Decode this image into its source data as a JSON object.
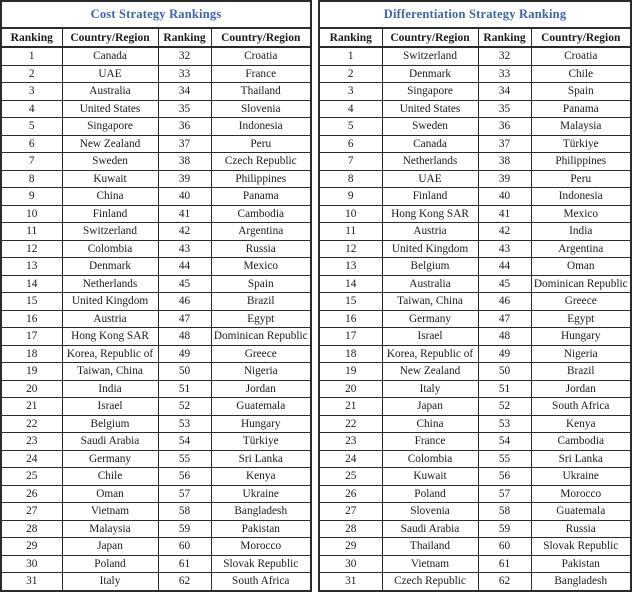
{
  "tables": [
    {
      "id": "cost-strategy",
      "title": "Cost Strategy Rankings",
      "title_color": "#3c63ab",
      "headers": [
        "Ranking",
        "Country/Region",
        "Ranking",
        "Country/Region"
      ],
      "rows": [
        [
          "1",
          "Canada",
          "32",
          "Croatia"
        ],
        [
          "2",
          "UAE",
          "33",
          "France"
        ],
        [
          "3",
          "Australia",
          "34",
          "Thailand"
        ],
        [
          "4",
          "United States",
          "35",
          "Slovenia"
        ],
        [
          "5",
          "Singapore",
          "36",
          "Indonesia"
        ],
        [
          "6",
          "New Zealand",
          "37",
          "Peru"
        ],
        [
          "7",
          "Sweden",
          "38",
          "Czech Republic"
        ],
        [
          "8",
          "Kuwait",
          "39",
          "Philippines"
        ],
        [
          "9",
          "China",
          "40",
          "Panama"
        ],
        [
          "10",
          "Finland",
          "41",
          "Cambodia"
        ],
        [
          "11",
          "Switzerland",
          "42",
          "Argentina"
        ],
        [
          "12",
          "Colombia",
          "43",
          "Russia"
        ],
        [
          "13",
          "Denmark",
          "44",
          "Mexico"
        ],
        [
          "14",
          "Netherlands",
          "45",
          "Spain"
        ],
        [
          "15",
          "United Kingdom",
          "46",
          "Brazil"
        ],
        [
          "16",
          "Austria",
          "47",
          "Egypt"
        ],
        [
          "17",
          "Hong Kong SAR",
          "48",
          "Dominican Republic"
        ],
        [
          "18",
          "Korea, Republic of",
          "49",
          "Greece"
        ],
        [
          "19",
          "Taiwan, China",
          "50",
          "Nigeria"
        ],
        [
          "20",
          "India",
          "51",
          "Jordan"
        ],
        [
          "21",
          "Israel",
          "52",
          "Guatemala"
        ],
        [
          "22",
          "Belgium",
          "53",
          "Hungary"
        ],
        [
          "23",
          "Saudi Arabia",
          "54",
          "Türkiye"
        ],
        [
          "24",
          "Germany",
          "55",
          "Sri Lanka"
        ],
        [
          "25",
          "Chile",
          "56",
          "Kenya"
        ],
        [
          "26",
          "Oman",
          "57",
          "Ukraine"
        ],
        [
          "27",
          "Vietnam",
          "58",
          "Bangladesh"
        ],
        [
          "28",
          "Malaysia",
          "59",
          "Pakistan"
        ],
        [
          "29",
          "Japan",
          "60",
          "Morocco"
        ],
        [
          "30",
          "Poland",
          "61",
          "Slovak Republic"
        ],
        [
          "31",
          "Italy",
          "62",
          "South Africa"
        ]
      ]
    },
    {
      "id": "differentiation-strategy",
      "title": "Differentiation Strategy Ranking",
      "title_color": "#3c63ab",
      "headers": [
        "Ranking",
        "Country/Region",
        "Ranking",
        "Country/Region"
      ],
      "rows": [
        [
          "1",
          "Switzerland",
          "32",
          "Croatia"
        ],
        [
          "2",
          "Denmark",
          "33",
          "Chile"
        ],
        [
          "3",
          "Singapore",
          "34",
          "Spain"
        ],
        [
          "4",
          "United States",
          "35",
          "Panama"
        ],
        [
          "5",
          "Sweden",
          "36",
          "Malaysia"
        ],
        [
          "6",
          "Canada",
          "37",
          "Türkiye"
        ],
        [
          "7",
          "Netherlands",
          "38",
          "Philippines"
        ],
        [
          "8",
          "UAE",
          "39",
          "Peru"
        ],
        [
          "9",
          "Finland",
          "40",
          "Indonesia"
        ],
        [
          "10",
          "Hong Kong SAR",
          "41",
          "Mexico"
        ],
        [
          "11",
          "Austria",
          "42",
          "India"
        ],
        [
          "12",
          "United Kingdom",
          "43",
          "Argentina"
        ],
        [
          "13",
          "Belgium",
          "44",
          "Oman"
        ],
        [
          "14",
          "Australia",
          "45",
          "Dominican Republic"
        ],
        [
          "15",
          "Taiwan, China",
          "46",
          "Greece"
        ],
        [
          "16",
          "Germany",
          "47",
          "Egypt"
        ],
        [
          "17",
          "Israel",
          "48",
          "Hungary"
        ],
        [
          "18",
          "Korea, Republic of",
          "49",
          "Nigeria"
        ],
        [
          "19",
          "New Zealand",
          "50",
          "Brazil"
        ],
        [
          "20",
          "Italy",
          "51",
          "Jordan"
        ],
        [
          "21",
          "Japan",
          "52",
          "South Africa"
        ],
        [
          "22",
          "China",
          "53",
          "Kenya"
        ],
        [
          "23",
          "France",
          "54",
          "Cambodia"
        ],
        [
          "24",
          "Colombia",
          "55",
          "Sri Lanka"
        ],
        [
          "25",
          "Kuwait",
          "56",
          "Ukraine"
        ],
        [
          "26",
          "Poland",
          "57",
          "Morocco"
        ],
        [
          "27",
          "Slovenia",
          "58",
          "Guatemala"
        ],
        [
          "28",
          "Saudi Arabia",
          "59",
          "Russia"
        ],
        [
          "29",
          "Thailand",
          "60",
          "Slovak Republic"
        ],
        [
          "30",
          "Vietnam",
          "61",
          "Pakistan"
        ],
        [
          "31",
          "Czech Republic",
          "62",
          "Bangladesh"
        ]
      ]
    }
  ]
}
